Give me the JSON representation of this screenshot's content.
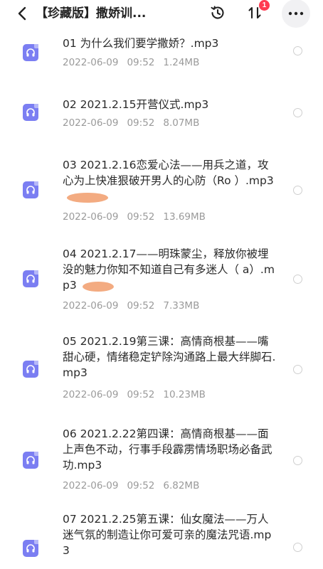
{
  "header": {
    "title": "【珍藏版】撒娇训...",
    "sort_badge_count": "1",
    "icons": {
      "back": "back-chevron-icon",
      "history": "history-clock-icon",
      "sort": "sort-arrows-icon",
      "more": "more-dots-icon"
    }
  },
  "colors": {
    "file_icon": "#7b7ef2",
    "badge": "#ff3b52",
    "meta_text": "#9a9a9a",
    "redaction_smudge": "#f2a273"
  },
  "files": [
    {
      "title": "01 为什么我们要学撒娇？.mp3",
      "date": "2022-06-09",
      "time": "09:52",
      "size": "1.24MB",
      "icon": "audio-file-icon"
    },
    {
      "title": "02 2021.2.15开营仪式.mp3",
      "date": "2022-06-09",
      "time": "09:52",
      "size": "8.07MB",
      "icon": "audio-file-icon"
    },
    {
      "title": "03 2021.2.16恋爱心法——用兵之道，攻心为上快准狠破开男人的心防（Ro  ）.mp3",
      "date": "2022-06-09",
      "time": "09:52",
      "size": "13.69MB",
      "icon": "audio-file-icon"
    },
    {
      "title": "04 2021.2.17——明珠蒙尘，释放你被埋没的魅力你知不知道自己有多迷人（    a）.mp3",
      "date": "2022-06-09",
      "time": "09:52",
      "size": "7.33MB",
      "icon": "audio-file-icon"
    },
    {
      "title": "05 2021.2.19第三课：高情商根基——嘴甜心硬，情绪稳定铲除沟通路上最大绊脚石.mp3",
      "date": "2022-06-09",
      "time": "09:52",
      "size": "10.23MB",
      "icon": "audio-file-icon"
    },
    {
      "title": "06 2021.2.22第四课：高情商根基——面上声色不动，行事手段霹雳情场职场必备武功.mp3",
      "date": "2022-06-09",
      "time": "09:52",
      "size": "6.82MB",
      "icon": "audio-file-icon"
    },
    {
      "title": "07 2021.2.25第五课：仙女魔法——万人迷气氛的制造让你可爱可亲的魔法咒语.mp3",
      "date": "",
      "time": "",
      "size": "",
      "icon": "audio-file-icon"
    }
  ]
}
